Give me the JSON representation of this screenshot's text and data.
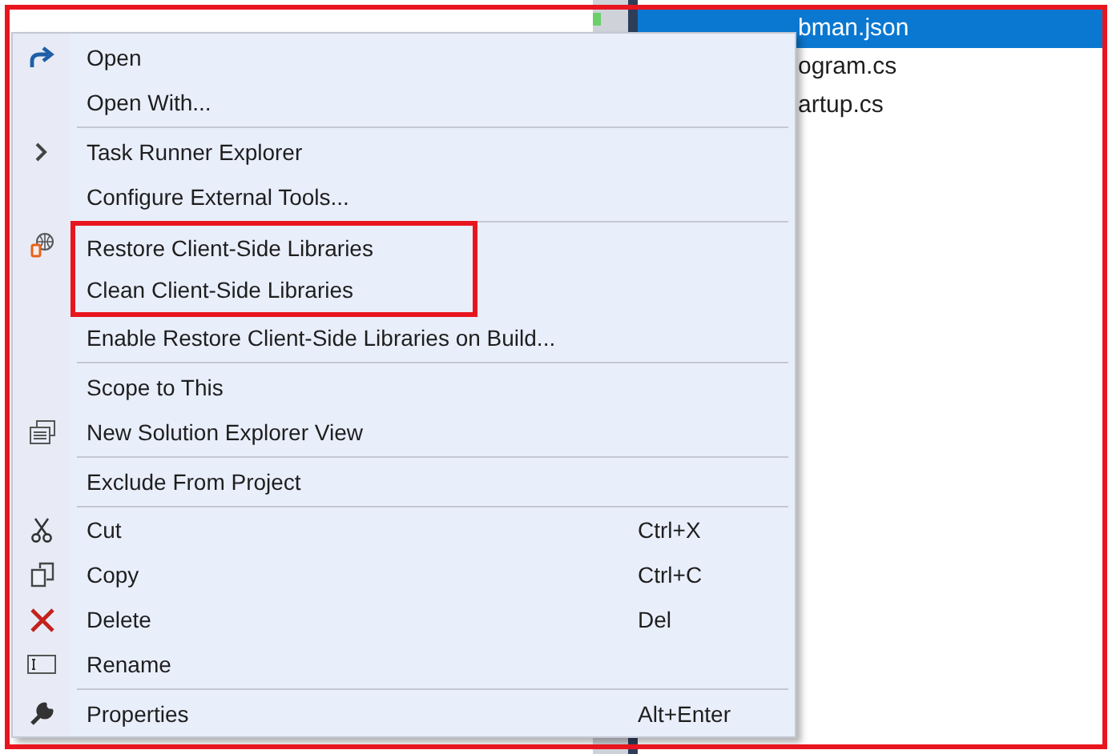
{
  "tree": {
    "rows": [
      {
        "name": "bman.json",
        "selected": true
      },
      {
        "name": "ogram.cs",
        "selected": false
      },
      {
        "name": "artup.cs",
        "selected": false
      }
    ]
  },
  "context_menu": {
    "items": [
      {
        "kind": "item",
        "label": "Open",
        "highlighted": false
      },
      {
        "kind": "item",
        "label": "Open With...",
        "highlighted": false
      },
      {
        "kind": "separator"
      },
      {
        "kind": "item",
        "label": "Task Runner Explorer",
        "highlighted": false
      },
      {
        "kind": "item",
        "label": "Configure External Tools...",
        "highlighted": false
      },
      {
        "kind": "separator"
      },
      {
        "kind": "item",
        "label": "Restore Client-Side Libraries",
        "highlighted": true
      },
      {
        "kind": "item",
        "label": "Clean Client-Side Libraries",
        "highlighted": true
      },
      {
        "kind": "item",
        "label": "Enable Restore Client-Side Libraries on Build...",
        "highlighted": false
      },
      {
        "kind": "separator"
      },
      {
        "kind": "item",
        "label": "Scope to This",
        "highlighted": false
      },
      {
        "kind": "item",
        "label": "New Solution Explorer View",
        "highlighted": false
      },
      {
        "kind": "separator"
      },
      {
        "kind": "item",
        "label": "Exclude From Project",
        "highlighted": false
      },
      {
        "kind": "separator"
      },
      {
        "kind": "item",
        "label": "Cut",
        "shortcut": "Ctrl+X",
        "highlighted": false
      },
      {
        "kind": "item",
        "label": "Copy",
        "shortcut": "Ctrl+C",
        "highlighted": false
      },
      {
        "kind": "item",
        "label": "Delete",
        "shortcut": "Del",
        "highlighted": false
      },
      {
        "kind": "item",
        "label": "Rename",
        "highlighted": false
      },
      {
        "kind": "separator"
      },
      {
        "kind": "item",
        "label": "Properties",
        "shortcut": "Alt+Enter",
        "highlighted": false
      }
    ]
  }
}
